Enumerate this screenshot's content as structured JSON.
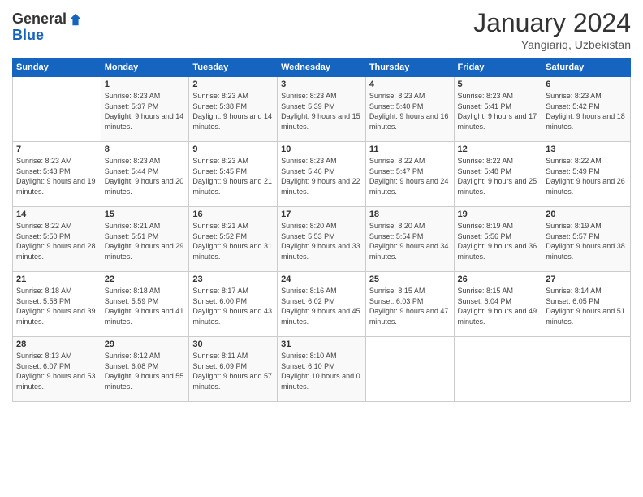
{
  "logo": {
    "general": "General",
    "blue": "Blue"
  },
  "title": "January 2024",
  "location": "Yangiariq, Uzbekistan",
  "days_of_week": [
    "Sunday",
    "Monday",
    "Tuesday",
    "Wednesday",
    "Thursday",
    "Friday",
    "Saturday"
  ],
  "weeks": [
    [
      {
        "day": "",
        "sunrise": "",
        "sunset": "",
        "daylight": ""
      },
      {
        "day": "1",
        "sunrise": "Sunrise: 8:23 AM",
        "sunset": "Sunset: 5:37 PM",
        "daylight": "Daylight: 9 hours and 14 minutes."
      },
      {
        "day": "2",
        "sunrise": "Sunrise: 8:23 AM",
        "sunset": "Sunset: 5:38 PM",
        "daylight": "Daylight: 9 hours and 14 minutes."
      },
      {
        "day": "3",
        "sunrise": "Sunrise: 8:23 AM",
        "sunset": "Sunset: 5:39 PM",
        "daylight": "Daylight: 9 hours and 15 minutes."
      },
      {
        "day": "4",
        "sunrise": "Sunrise: 8:23 AM",
        "sunset": "Sunset: 5:40 PM",
        "daylight": "Daylight: 9 hours and 16 minutes."
      },
      {
        "day": "5",
        "sunrise": "Sunrise: 8:23 AM",
        "sunset": "Sunset: 5:41 PM",
        "daylight": "Daylight: 9 hours and 17 minutes."
      },
      {
        "day": "6",
        "sunrise": "Sunrise: 8:23 AM",
        "sunset": "Sunset: 5:42 PM",
        "daylight": "Daylight: 9 hours and 18 minutes."
      }
    ],
    [
      {
        "day": "7",
        "sunrise": "Sunrise: 8:23 AM",
        "sunset": "Sunset: 5:43 PM",
        "daylight": "Daylight: 9 hours and 19 minutes."
      },
      {
        "day": "8",
        "sunrise": "Sunrise: 8:23 AM",
        "sunset": "Sunset: 5:44 PM",
        "daylight": "Daylight: 9 hours and 20 minutes."
      },
      {
        "day": "9",
        "sunrise": "Sunrise: 8:23 AM",
        "sunset": "Sunset: 5:45 PM",
        "daylight": "Daylight: 9 hours and 21 minutes."
      },
      {
        "day": "10",
        "sunrise": "Sunrise: 8:23 AM",
        "sunset": "Sunset: 5:46 PM",
        "daylight": "Daylight: 9 hours and 22 minutes."
      },
      {
        "day": "11",
        "sunrise": "Sunrise: 8:22 AM",
        "sunset": "Sunset: 5:47 PM",
        "daylight": "Daylight: 9 hours and 24 minutes."
      },
      {
        "day": "12",
        "sunrise": "Sunrise: 8:22 AM",
        "sunset": "Sunset: 5:48 PM",
        "daylight": "Daylight: 9 hours and 25 minutes."
      },
      {
        "day": "13",
        "sunrise": "Sunrise: 8:22 AM",
        "sunset": "Sunset: 5:49 PM",
        "daylight": "Daylight: 9 hours and 26 minutes."
      }
    ],
    [
      {
        "day": "14",
        "sunrise": "Sunrise: 8:22 AM",
        "sunset": "Sunset: 5:50 PM",
        "daylight": "Daylight: 9 hours and 28 minutes."
      },
      {
        "day": "15",
        "sunrise": "Sunrise: 8:21 AM",
        "sunset": "Sunset: 5:51 PM",
        "daylight": "Daylight: 9 hours and 29 minutes."
      },
      {
        "day": "16",
        "sunrise": "Sunrise: 8:21 AM",
        "sunset": "Sunset: 5:52 PM",
        "daylight": "Daylight: 9 hours and 31 minutes."
      },
      {
        "day": "17",
        "sunrise": "Sunrise: 8:20 AM",
        "sunset": "Sunset: 5:53 PM",
        "daylight": "Daylight: 9 hours and 33 minutes."
      },
      {
        "day": "18",
        "sunrise": "Sunrise: 8:20 AM",
        "sunset": "Sunset: 5:54 PM",
        "daylight": "Daylight: 9 hours and 34 minutes."
      },
      {
        "day": "19",
        "sunrise": "Sunrise: 8:19 AM",
        "sunset": "Sunset: 5:56 PM",
        "daylight": "Daylight: 9 hours and 36 minutes."
      },
      {
        "day": "20",
        "sunrise": "Sunrise: 8:19 AM",
        "sunset": "Sunset: 5:57 PM",
        "daylight": "Daylight: 9 hours and 38 minutes."
      }
    ],
    [
      {
        "day": "21",
        "sunrise": "Sunrise: 8:18 AM",
        "sunset": "Sunset: 5:58 PM",
        "daylight": "Daylight: 9 hours and 39 minutes."
      },
      {
        "day": "22",
        "sunrise": "Sunrise: 8:18 AM",
        "sunset": "Sunset: 5:59 PM",
        "daylight": "Daylight: 9 hours and 41 minutes."
      },
      {
        "day": "23",
        "sunrise": "Sunrise: 8:17 AM",
        "sunset": "Sunset: 6:00 PM",
        "daylight": "Daylight: 9 hours and 43 minutes."
      },
      {
        "day": "24",
        "sunrise": "Sunrise: 8:16 AM",
        "sunset": "Sunset: 6:02 PM",
        "daylight": "Daylight: 9 hours and 45 minutes."
      },
      {
        "day": "25",
        "sunrise": "Sunrise: 8:15 AM",
        "sunset": "Sunset: 6:03 PM",
        "daylight": "Daylight: 9 hours and 47 minutes."
      },
      {
        "day": "26",
        "sunrise": "Sunrise: 8:15 AM",
        "sunset": "Sunset: 6:04 PM",
        "daylight": "Daylight: 9 hours and 49 minutes."
      },
      {
        "day": "27",
        "sunrise": "Sunrise: 8:14 AM",
        "sunset": "Sunset: 6:05 PM",
        "daylight": "Daylight: 9 hours and 51 minutes."
      }
    ],
    [
      {
        "day": "28",
        "sunrise": "Sunrise: 8:13 AM",
        "sunset": "Sunset: 6:07 PM",
        "daylight": "Daylight: 9 hours and 53 minutes."
      },
      {
        "day": "29",
        "sunrise": "Sunrise: 8:12 AM",
        "sunset": "Sunset: 6:08 PM",
        "daylight": "Daylight: 9 hours and 55 minutes."
      },
      {
        "day": "30",
        "sunrise": "Sunrise: 8:11 AM",
        "sunset": "Sunset: 6:09 PM",
        "daylight": "Daylight: 9 hours and 57 minutes."
      },
      {
        "day": "31",
        "sunrise": "Sunrise: 8:10 AM",
        "sunset": "Sunset: 6:10 PM",
        "daylight": "Daylight: 10 hours and 0 minutes."
      },
      {
        "day": "",
        "sunrise": "",
        "sunset": "",
        "daylight": ""
      },
      {
        "day": "",
        "sunrise": "",
        "sunset": "",
        "daylight": ""
      },
      {
        "day": "",
        "sunrise": "",
        "sunset": "",
        "daylight": ""
      }
    ]
  ]
}
